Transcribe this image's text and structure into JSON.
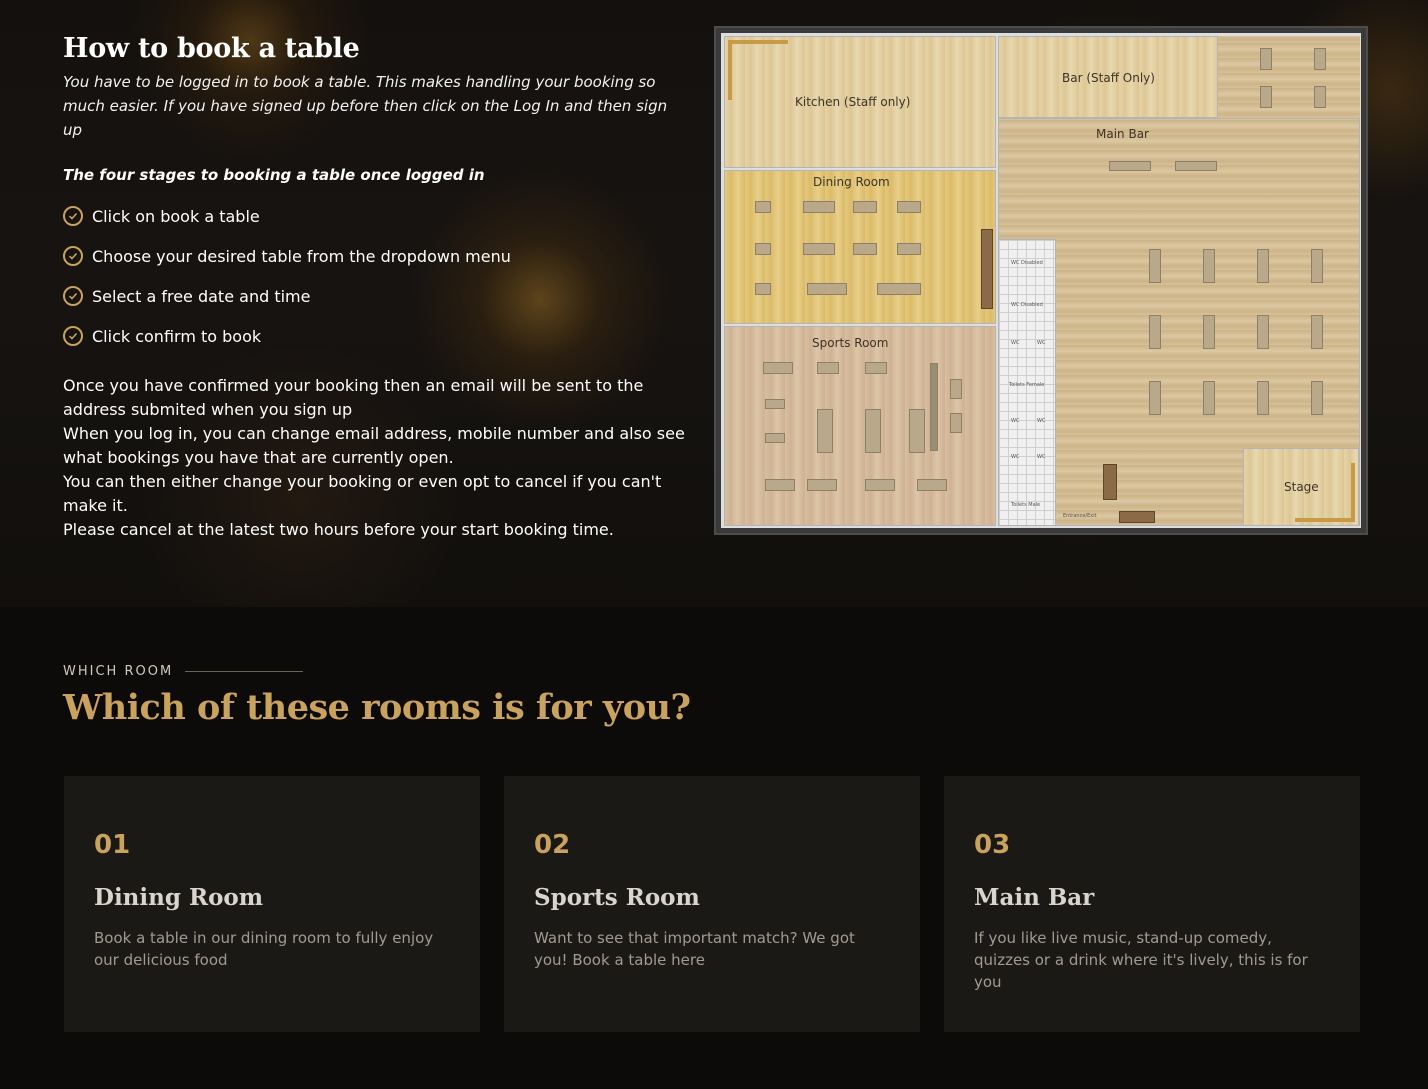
{
  "how_to": {
    "title": "How to book a table",
    "intro": "You have to be logged in to book a table. This makes handling your booking so much easier. If you have signed up before then click on the Log In and then sign up",
    "stages_heading": "The four stages to booking a table once logged in",
    "steps": [
      "Click on book a table",
      "Choose your desired table from the dropdown menu",
      "Select a free date and time",
      "Click confirm to book"
    ],
    "outro": [
      "Once you have confirmed your booking then an email will be sent to the address submited when you sign up",
      "When you log in, you can change email address, mobile number and also see what bookings you have that are currently open.",
      "You can then either change your booking or even opt to cancel if you can't make it.",
      "Please cancel at the latest two hours before your start booking time."
    ]
  },
  "floor_plan": {
    "kitchen": "Kitchen (Staff only)",
    "bar_staff": "Bar (Staff Only)",
    "main_bar": "Main Bar",
    "dining_room": "Dining Room",
    "sports_room": "Sports Room",
    "stage": "Stage",
    "wc_disabled_1": "WC Disabled",
    "wc_disabled_2": "WC Disabled",
    "wc": "WC",
    "toilets_female": "Toilets Female",
    "toilets_male": "Toilets Male",
    "entrance": "Entrance/Exit"
  },
  "rooms": {
    "eyebrow": "WHICH ROOM",
    "title": "Which of these rooms is for you?",
    "cards": [
      {
        "number": "01",
        "name": "Dining Room",
        "description": "Book a table in our dining room to fully enjoy our delicious food"
      },
      {
        "number": "02",
        "name": "Sports Room",
        "description": "Want to see that important match? We got you! Book a table here"
      },
      {
        "number": "03",
        "name": "Main Bar",
        "description": "If you like live music, stand-up comedy, quizzes or a drink where it's lively, this is for you"
      }
    ]
  },
  "colors": {
    "accent": "#c9a25e",
    "card_bg": "#1b1916",
    "page_bg": "#0d0b0a"
  },
  "icons": {
    "step_bullet": "check-circle-icon"
  }
}
